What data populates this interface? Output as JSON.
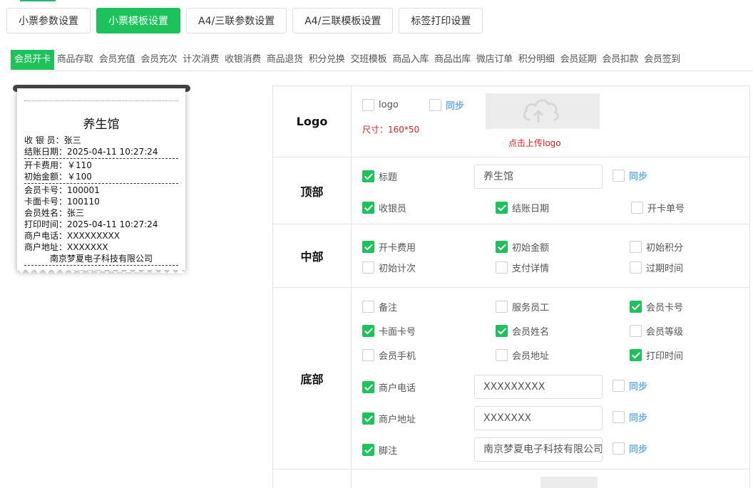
{
  "top_tabs": [
    {
      "label": "小票参数设置",
      "active": false
    },
    {
      "label": "小票模板设置",
      "active": true
    },
    {
      "label": "A4/三联参数设置",
      "active": false
    },
    {
      "label": "A4/三联模板设置",
      "active": false
    },
    {
      "label": "标签打印设置",
      "active": false
    }
  ],
  "sub_tabs": [
    "会员开卡",
    "商品存取",
    "会员充值",
    "会员充次",
    "计次消费",
    "收银消费",
    "商品退货",
    "积分兑换",
    "交班模板",
    "商品入库",
    "商品出库",
    "微店订单",
    "积分明细",
    "会员延期",
    "会员扣款",
    "会员签到"
  ],
  "sub_tab_active": "会员开卡",
  "receipt": {
    "shop": "养生馆",
    "lines_a": [
      "收 银 员：张三",
      "结账日期：2025-04-11 10:27:24"
    ],
    "lines_b": [
      "开卡费用：￥110",
      "初始金额：￥100"
    ],
    "lines_c": [
      "会员卡号：100001",
      "卡面卡号：100110",
      "会员姓名：张三",
      "打印时间：2025-04-11 10:27:24",
      "商户电话：XXXXXXXXX",
      "商户地址：XXXXXXX"
    ],
    "footer": "南京梦夏电子科技有限公司"
  },
  "sections": {
    "logo": {
      "label": "Logo",
      "logo_cb": "logo",
      "sync": "同步",
      "size_hint": "尺寸：160*50",
      "upload_text": "点击上传logo"
    },
    "top": {
      "label": "顶部",
      "title_cb": "标题",
      "title_value": "养生馆",
      "sync": "同步",
      "cashier": "收银员",
      "checkout_date": "结账日期",
      "card_order_no": "开卡单号"
    },
    "middle": {
      "label": "中部",
      "items": [
        "开卡费用",
        "初始金额",
        "初始积分",
        "初始计次",
        "支付详情",
        "过期时间"
      ]
    },
    "bottom": {
      "label": "底部",
      "items": [
        "备注",
        "服务员工",
        "会员卡号",
        "卡面卡号",
        "会员姓名",
        "会员等级",
        "会员手机",
        "会员地址",
        "打印时间"
      ],
      "merchant_phone": "商户电话",
      "merchant_phone_value": "XXXXXXXXX",
      "merchant_addr": "商户地址",
      "merchant_addr_value": "XXXXXXX",
      "footnote": "脚注",
      "footnote_value": "南京梦夏电子科技有限公司",
      "sync": "同步"
    }
  },
  "colors": {
    "accent": "#1bc35a",
    "sync": "#6fb0e0",
    "warn": "#e02020"
  }
}
